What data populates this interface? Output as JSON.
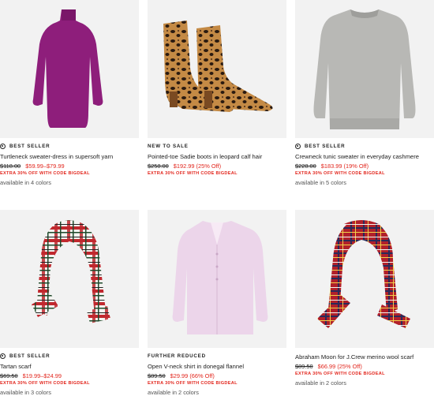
{
  "products": [
    {
      "badge": "BEST SELLER",
      "name": "Turtleneck sweater-dress in supersoft yarn",
      "original_price": "$118.00",
      "sale_price": "$59.99–$79.99",
      "promo": "EXTRA 30% OFF WITH CODE BIGDEAL",
      "colors": "available in 4 colors",
      "image_icon": "purple-sweater-dress",
      "accent_color": "#8e1e7b"
    },
    {
      "badge": "NEW TO SALE",
      "name": "Pointed-toe Sadie boots in leopard calf hair",
      "original_price": "$258.00",
      "sale_price": "$192.99 (25% Off)",
      "promo": "EXTRA 30% OFF WITH CODE BIGDEAL",
      "colors": "",
      "image_icon": "leopard-boots",
      "accent_color": "#b07a3c"
    },
    {
      "badge": "BEST SELLER",
      "name": "Crewneck tunic sweater in everyday cashmere",
      "original_price": "$228.00",
      "sale_price": "$183.99 (19% Off)",
      "promo": "EXTRA 30% OFF WITH CODE BIGDEAL",
      "colors": "available in 5 colors",
      "image_icon": "grey-tunic-sweater",
      "accent_color": "#b7b7b4"
    },
    {
      "badge": "BEST SELLER",
      "name": "Tartan scarf",
      "original_price": "$69.50",
      "sale_price": "$19.99–$24.99",
      "promo": "EXTRA 30% OFF WITH CODE BIGDEAL",
      "colors": "available in 3 colors",
      "image_icon": "tartan-scarf",
      "accent_color": "#c0282e"
    },
    {
      "badge": "FURTHER REDUCED",
      "name": "Open V-neck shirt in donegal flannel",
      "original_price": "$89.50",
      "sale_price": "$29.99 (66% Off)",
      "promo": "EXTRA 30% OFF WITH CODE BIGDEAL",
      "colors": "available in 2 colors",
      "image_icon": "pink-flannel-shirt",
      "accent_color": "#eed7ea"
    },
    {
      "badge": "",
      "name": "Abraham Moon for J.Crew merino wool scarf",
      "original_price": "$89.50",
      "sale_price": "$66.99 (25% Off)",
      "promo": "EXTRA 30% OFF WITH CODE BIGDEAL",
      "colors": "available in 2 colors",
      "image_icon": "red-plaid-scarf",
      "accent_color": "#b1202a"
    }
  ]
}
